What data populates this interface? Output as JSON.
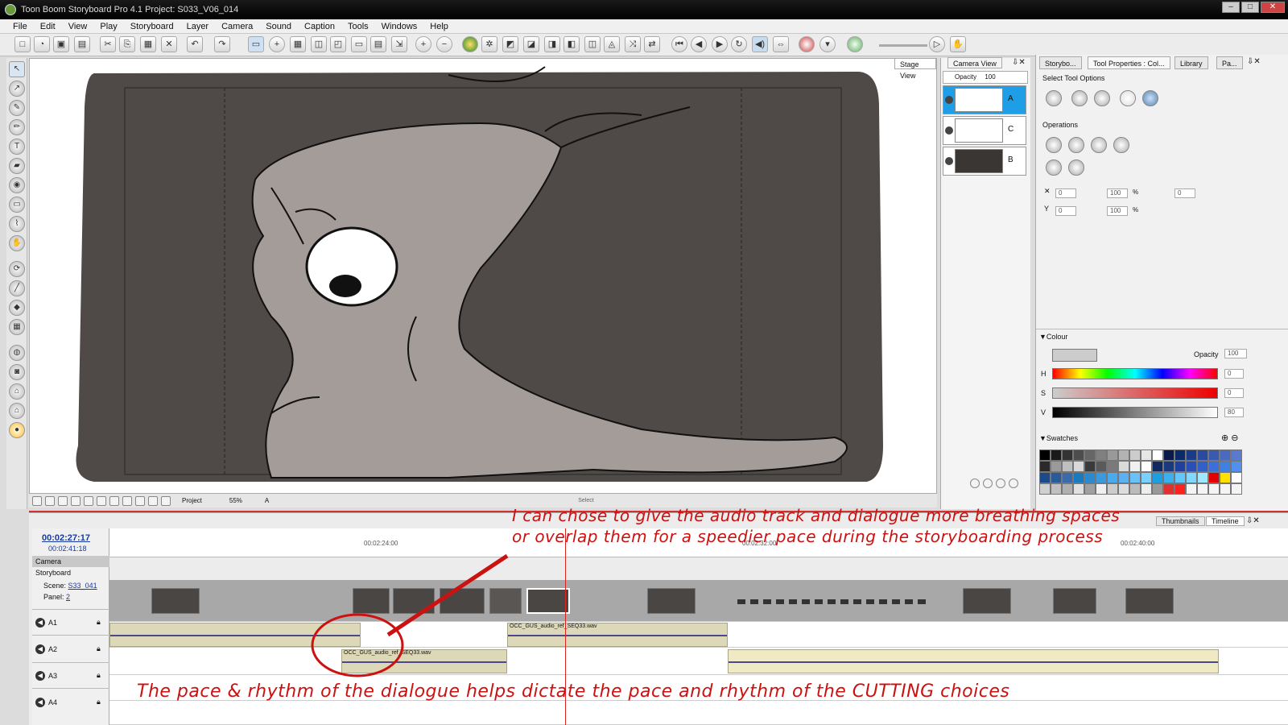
{
  "window": {
    "title": "Toon Boom Storyboard Pro 4.1 Project: S033_V06_014"
  },
  "menu": [
    "File",
    "Edit",
    "View",
    "Play",
    "Storyboard",
    "Layer",
    "Camera",
    "Sound",
    "Caption",
    "Tools",
    "Windows",
    "Help"
  ],
  "stage_panel": {
    "tabs": [
      "Stage View",
      "Camera View"
    ],
    "opacity_label": "Opacity",
    "opacity_value": "100",
    "layers": [
      "A",
      "C",
      "B"
    ],
    "bottom_mode": "Project",
    "zoom": "55%",
    "layer_indicator": "A",
    "select_label": "Select"
  },
  "right_panel": {
    "tabs": [
      "Storybo...",
      "Tool Properties : Col...",
      "Library",
      "Pa..."
    ],
    "select_tool_options": "Select Tool Options",
    "operations": "Operations",
    "fields": {
      "x": "0",
      "y": "0",
      "w": "100",
      "h": "100",
      "angle": "0",
      "pct1": "%",
      "pct2": "%"
    },
    "colour": {
      "title": "Colour",
      "opacity_label": "Opacity",
      "opacity_value": "100",
      "h_label": "H",
      "h_value": "0",
      "s_label": "S",
      "s_value": "0",
      "v_label": "V",
      "v_value": "80",
      "current_color": "#cccccc"
    },
    "swatches_title": "Swatches",
    "swatch_colors": [
      "#000000",
      "#1a1a1a",
      "#333333",
      "#4d4d4d",
      "#666666",
      "#808080",
      "#999999",
      "#b3b3b3",
      "#cccccc",
      "#e6e6e6",
      "#ffffff",
      "#0a1a4a",
      "#0a2a6a",
      "#1a3a8a",
      "#2a4aa0",
      "#3a5ab0",
      "#4a6ac0",
      "#5a7ad0",
      "#2a2a2a",
      "#9a9a9a",
      "#bfbfbf",
      "#d9d9d9",
      "#3a3a3a",
      "#5a5a5a",
      "#7a7a7a",
      "#dadada",
      "#f0f0f0",
      "#ffffff",
      "#102a60",
      "#1a3a80",
      "#2040a0",
      "#2850b8",
      "#3060c8",
      "#3a70d8",
      "#4080e0",
      "#5090f0",
      "#1a4a8a",
      "#2a5a9a",
      "#3a6aaa",
      "#1a7ac0",
      "#2a8ad0",
      "#3a9ae0",
      "#4aaaf0",
      "#5ab0f0",
      "#6ac0f8",
      "#7ad0ff",
      "#1aa0e0",
      "#3ab0f0",
      "#60c8ff",
      "#80d8ff",
      "#a0e8ff",
      "#e00000",
      "#ffe000",
      "#ffffff",
      "#d0d0d0",
      "#c0c0c0",
      "#b0b0b0",
      "#e0e0e0",
      "#a0a0a0",
      "#f0f0f0",
      "#cccccc",
      "#dddddd",
      "#bbbbbb",
      "#eeeeee",
      "#999999",
      "#e03030",
      "#ff2020",
      "#f4f4f4",
      "#f4f4f4",
      "#f4f4f4",
      "#f4f4f4",
      "#f4f4f4"
    ]
  },
  "timeline": {
    "current_time": "00:02:27:17",
    "total_time": "00:02:41:18",
    "ruler_ticks": [
      "00:02:24:00",
      "00:02:32:00",
      "00:02:40:00"
    ],
    "bottom_tabs": [
      "Thumbnails",
      "Timeline"
    ],
    "camera_label": "Camera",
    "storyboard_label": "Storyboard",
    "scene_label": "Scene:",
    "scene_value": "S33_041",
    "panel_label": "Panel:",
    "panel_value": "2",
    "tracks": [
      "A1",
      "A2",
      "A3",
      "A4"
    ],
    "clip_a1": "OCC_GUS_audio_ref_SEQ33.wav",
    "clip_a2": "OCC_GUS_audio_ref_SEQ33.wav"
  },
  "annotations": {
    "top_line1": "I can chose to give the audio track and dialogue more breathing spaces",
    "top_line2": "or overlap them for a speedier pace during the storyboarding process",
    "bottom": "The pace & rhythm of the dialogue helps dictate the pace and rhythm of the CUTTING choices",
    "color": "#cc1111"
  }
}
